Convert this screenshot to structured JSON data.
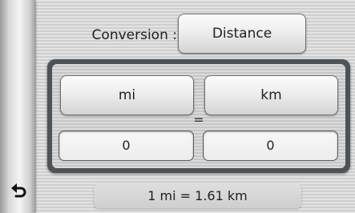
{
  "conversion": {
    "label": "Conversion :",
    "type_button": "Distance"
  },
  "units": {
    "left": "mi",
    "right": "km",
    "equals": "="
  },
  "values": {
    "left": "0",
    "right": "0"
  },
  "result": "1 mi = 1.61 km",
  "icons": {
    "back": "back-arrow-icon"
  }
}
